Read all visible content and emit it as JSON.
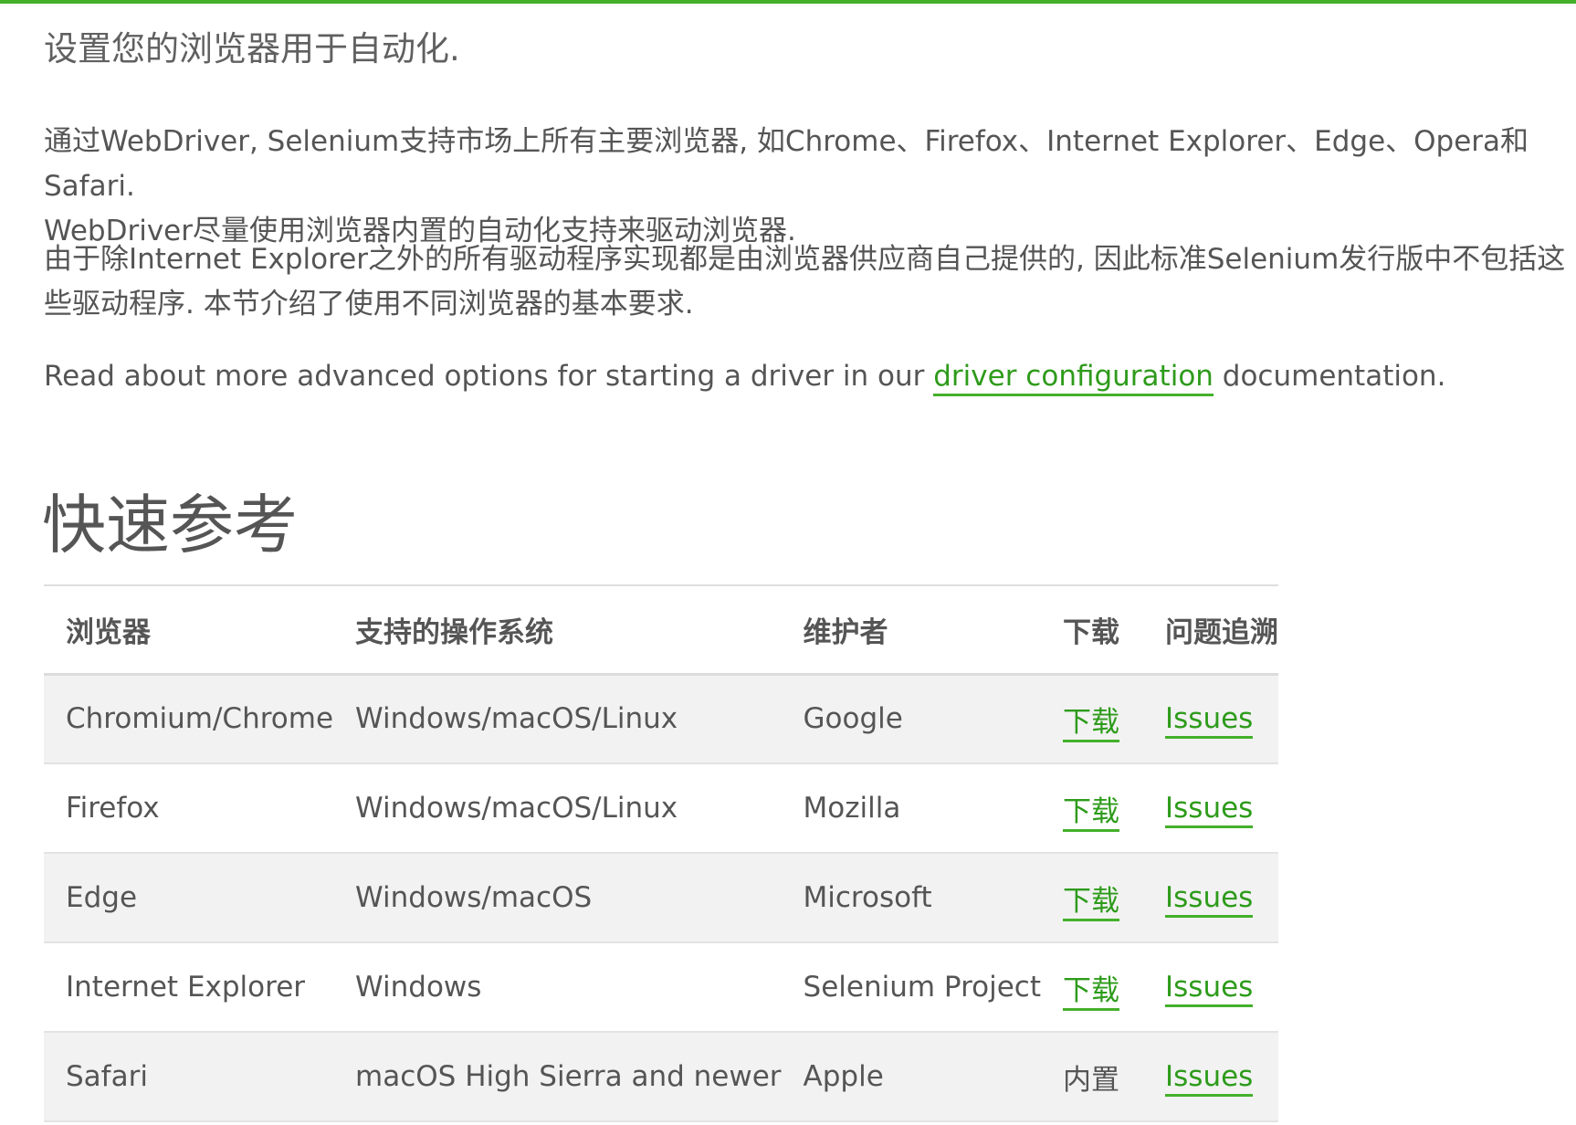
{
  "accent_color": "#43b02a",
  "link_color": "#2e9b1b",
  "lead": "设置您的浏览器用于自动化.",
  "paragraphs": {
    "p1_line1": "通过WebDriver, Selenium支持市场上所有主要浏览器, 如Chrome、Firefox、Internet Explorer、Edge、Opera和Safari.",
    "p1_line2": "WebDriver尽量使用浏览器内置的自动化支持来驱动浏览器.",
    "p2_line1": "由于除Internet Explorer之外的所有驱动程序实现都是由浏览器供应商自己提供的, 因此标准Selenium发行版中不包括这",
    "p2_line2": "些驱动程序. 本节介绍了使用不同浏览器的基本要求.",
    "p3_before": "Read about more advanced options for starting a driver in our ",
    "p3_link": "driver configuration",
    "p3_after": " documentation."
  },
  "section_title": "快速参考",
  "table": {
    "headers": {
      "browser": "浏览器",
      "os": "支持的操作系统",
      "maintainer": "维护者",
      "download": "下载",
      "issues": "问题追溯"
    },
    "rows": [
      {
        "browser": "Chromium/Chrome",
        "os": "Windows/macOS/Linux",
        "maintainer": "Google",
        "download": "下载",
        "download_is_link": true,
        "issues": "Issues"
      },
      {
        "browser": "Firefox",
        "os": "Windows/macOS/Linux",
        "maintainer": "Mozilla",
        "download": "下载",
        "download_is_link": true,
        "issues": "Issues"
      },
      {
        "browser": "Edge",
        "os": "Windows/macOS",
        "maintainer": "Microsoft",
        "download": "下载",
        "download_is_link": true,
        "issues": "Issues"
      },
      {
        "browser": "Internet Explorer",
        "os": "Windows",
        "maintainer": "Selenium Project",
        "download": "下载",
        "download_is_link": true,
        "issues": "Issues"
      },
      {
        "browser": "Safari",
        "os": "macOS High Sierra and newer",
        "maintainer": "Apple",
        "download": "内置",
        "download_is_link": false,
        "issues": "Issues"
      }
    ]
  }
}
